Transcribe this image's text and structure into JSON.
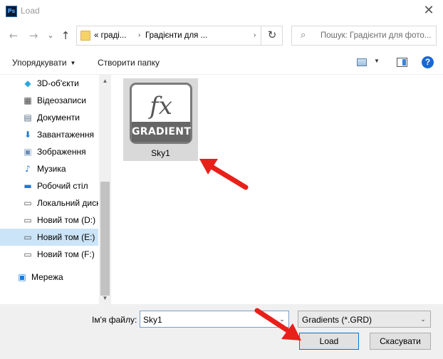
{
  "window": {
    "app_icon": "Ps",
    "title": "Load",
    "close_glyph": "✕"
  },
  "nav": {
    "back_glyph": "←",
    "forward_glyph": "→",
    "recent_glyph": "⌄",
    "up_glyph": "↑",
    "breadcrumb": [
      "« граді...",
      "Градієнти для ..."
    ],
    "chevron_glyph": "›",
    "refresh_glyph": "↻",
    "search_placeholder": "Пошук: Градієнти для фото...",
    "search_icon": "search-icon"
  },
  "toolbar": {
    "organize_label": "Упорядкувати",
    "organize_arrow": "▼",
    "new_folder_label": "Створити папку",
    "view_arrow": "▼",
    "help_label": "?"
  },
  "sidebar": {
    "items": [
      {
        "label": "3D-об'єкти",
        "icon": "cube-icon",
        "glyph": "◆",
        "color": "#29a8e0"
      },
      {
        "label": "Відеозаписи",
        "icon": "film-icon",
        "glyph": "▦",
        "color": "#444444"
      },
      {
        "label": "Документи",
        "icon": "document-icon",
        "glyph": "▤",
        "color": "#5b6f86"
      },
      {
        "label": "Завантаження",
        "icon": "download-icon",
        "glyph": "⬇",
        "color": "#1d78d6"
      },
      {
        "label": "Зображення",
        "icon": "picture-icon",
        "glyph": "▣",
        "color": "#6b8fb3"
      },
      {
        "label": "Музика",
        "icon": "music-icon",
        "glyph": "♪",
        "color": "#1d78d6"
      },
      {
        "label": "Робочий стіл",
        "icon": "desktop-icon",
        "glyph": "▬",
        "color": "#1d78d6"
      },
      {
        "label": "Локальний диск",
        "icon": "local-disk-icon",
        "glyph": "▭",
        "color": "#555555"
      },
      {
        "label": "Новий том (D:)",
        "icon": "drive-icon",
        "glyph": "▭",
        "color": "#555555"
      },
      {
        "label": "Новий том (E:)",
        "icon": "drive-icon",
        "glyph": "▭",
        "color": "#555555",
        "selected": true
      },
      {
        "label": "Новий том (F:)",
        "icon": "drive-icon",
        "glyph": "▭",
        "color": "#555555"
      },
      {
        "label": "Мережа",
        "icon": "network-icon",
        "glyph": "▣",
        "color": "#1d78d6"
      }
    ],
    "scroll_up": "▲",
    "scroll_down": "▼"
  },
  "files": [
    {
      "name": "Sky1",
      "thumb_symbol": "fx",
      "thumb_caption": "GRADIENT"
    }
  ],
  "footer": {
    "filename_label": "Ім'я файлу:",
    "filename_value": "Sky1",
    "filetype_value": "Gradients (*.GRD)",
    "dropdown_glyph": "⌄",
    "load_label": "Load",
    "cancel_label": "Скасувати"
  },
  "colors": {
    "accent": "#0078d7",
    "selection": "#cce4f7",
    "annotation_arrow": "#e8201a"
  }
}
